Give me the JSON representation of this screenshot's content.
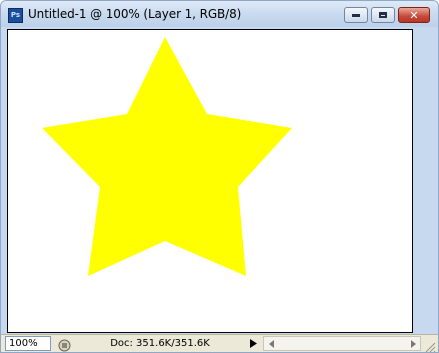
{
  "window": {
    "app_icon_text": "Ps",
    "title": "Untitled-1 @ 100% (Layer 1, RGB/8)"
  },
  "title_buttons": {
    "minimize_icon": "minimize-icon",
    "maximize_icon": "maximize-icon",
    "close_icon": "close-icon",
    "close_glyph": "✕"
  },
  "canvas": {
    "background_color": "#ffffff",
    "shape": "star",
    "star_color": "#ffff00"
  },
  "statusbar": {
    "zoom": "100%",
    "doc_info": "Doc: 351.6K/351.6K",
    "status_icon": "status-info-icon",
    "menu_arrow_icon": "play-arrow-icon",
    "scroll_left_icon": "scroll-left-icon",
    "scroll_right_icon": "scroll-right-icon"
  }
}
